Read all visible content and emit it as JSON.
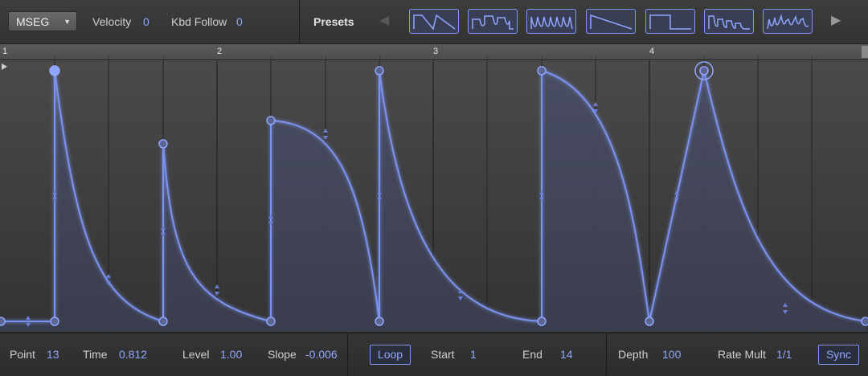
{
  "header": {
    "mode": "MSEG",
    "velocity_label": "Velocity",
    "velocity_value": "0",
    "kbd_follow_label": "Kbd Follow",
    "kbd_follow_value": "0",
    "presets_label": "Presets"
  },
  "ruler": {
    "numbers": [
      "1",
      "2",
      "3",
      "4"
    ]
  },
  "footer": {
    "point_label": "Point",
    "point_value": "13",
    "time_label": "Time",
    "time_value": "0.812",
    "level_label": "Level",
    "level_value": "1.00",
    "slope_label": "Slope",
    "slope_value": "-0.006",
    "loop_label": "Loop",
    "start_label": "Start",
    "start_value": "1",
    "end_label": "End",
    "end_value": "14",
    "depth_label": "Depth",
    "depth_value": "100",
    "rate_mult_label": "Rate Mult",
    "rate_mult_value": "1/1",
    "sync_label": "Sync"
  },
  "colors": {
    "accent": "#8fa6ff",
    "curve": "#7d93f0",
    "fill": "#3f4256",
    "background": "#2a2a2b"
  }
}
